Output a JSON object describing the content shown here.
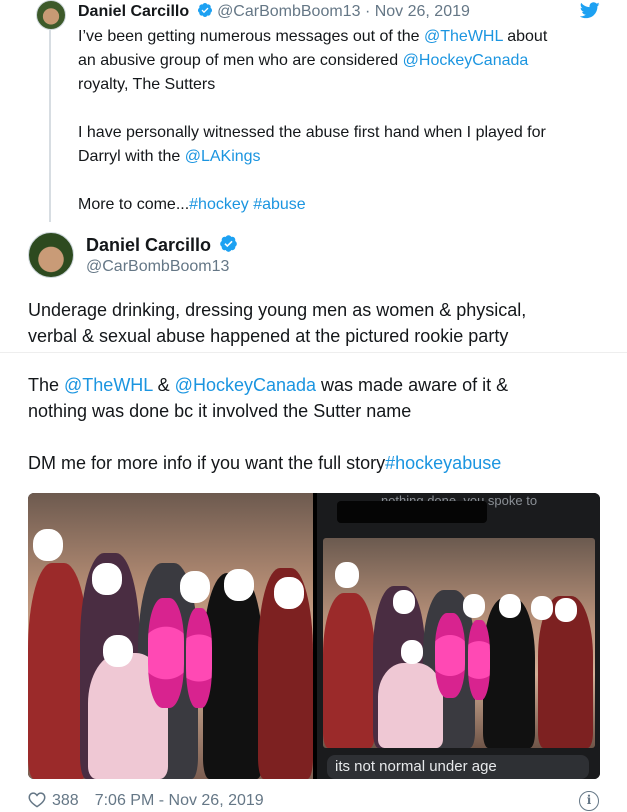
{
  "quoted_tweet": {
    "name": "Daniel Carcillo",
    "handle": "@CarBombBoom13",
    "separator": "·",
    "date": "Nov 26, 2019",
    "line1_pre": "I’ve been getting numerous messages out of the ",
    "line1_mention": "@TheWHL",
    "line1_post": " about",
    "line2_pre": "an abusive group of men who are considered ",
    "line2_mention": "@HockeyCanada",
    "line3": "royalty, The Sutters",
    "para2_line1": "I have personally witnessed the abuse first hand when I played for",
    "para2_line2_pre": "Darryl with the ",
    "para2_line2_mention": "@LAKings",
    "para3_pre": "More to come...",
    "para3_tag1": "#hockey",
    "para3_tag2": "#abuse"
  },
  "main_tweet": {
    "name": "Daniel Carcillo",
    "handle": "@CarBombBoom13",
    "text_line1": "Underage drinking, dressing young men as women & physical,",
    "text_line2": "verbal & sexual abuse happened at the pictured rookie party",
    "para2_pre": "The ",
    "para2_mention1": "@TheWHL",
    "para2_amp": " & ",
    "para2_mention2": "@HockeyCanada",
    "para2_post": " was made aware of it &",
    "para2_line2": "nothing was done bc it involved the Sutter name",
    "para3_pre": "DM me for more info if you want the full story",
    "para3_tag": "#hockeyabuse",
    "media": {
      "phone_top_text": "nothing done. you spoke to",
      "phone_caption": "its not normal under age"
    }
  },
  "footer": {
    "likes": "388",
    "timestamp": "7:06 PM - Nov 26, 2019",
    "info_glyph": "i"
  },
  "colors": {
    "link": "#1b95e0",
    "secondary_text": "#657786",
    "verified": "#1da1f2"
  }
}
